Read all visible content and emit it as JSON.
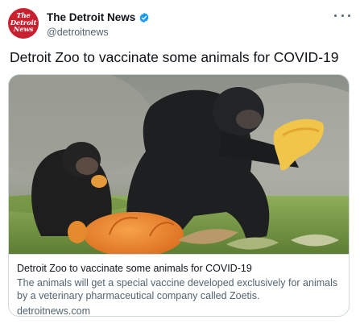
{
  "author": {
    "name": "The Detroit News",
    "handle": "@detroitnews",
    "avatar_lines": [
      "The",
      "Detroit",
      "News"
    ],
    "verified": true
  },
  "tweet": {
    "text": "Detroit Zoo to vaccinate some animals for COVID-19"
  },
  "card": {
    "image_icon": "photo-chimpanzees-eating-pumpkin",
    "title": "Detroit Zoo to vaccinate some animals for COVID-19",
    "description": "The animals will get a special vaccine developed exclusively for animals by a veterinary pharmaceutical company called Zoetis.",
    "domain": "detroitnews.com"
  },
  "colors": {
    "avatar_bg": "#c8202f",
    "verified_blue": "#1d9bf0",
    "secondary_text": "#536471",
    "border": "#cfd9de"
  }
}
